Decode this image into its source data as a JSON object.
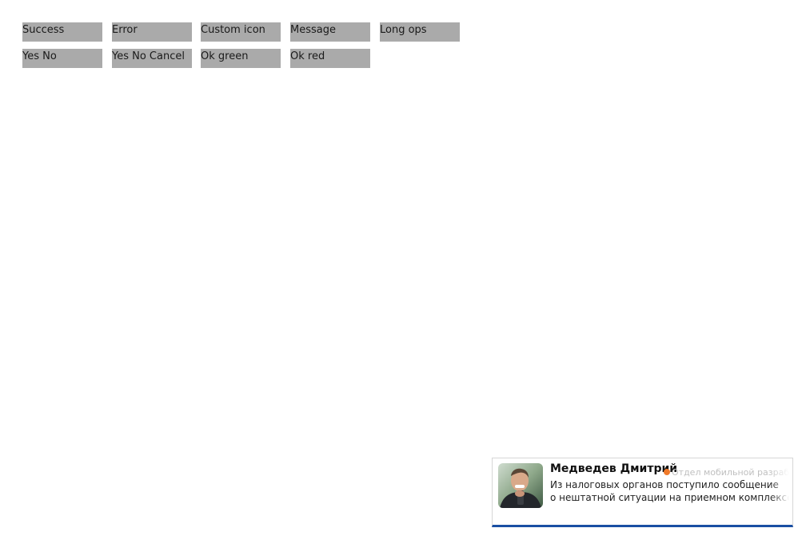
{
  "buttons": {
    "success": "Success",
    "error": "Error",
    "custom_icon": "Custom icon",
    "message": "Message",
    "long_ops": "Long ops",
    "yes_no": "Yes No",
    "yes_no_cancel": "Yes No Cancel",
    "ok_green": "Ok green",
    "ok_red": "Ok red"
  },
  "notification": {
    "sender": "Медведев Дмитрий",
    "department": "Отдел мобильной разработки",
    "message_line1": "Из налоговых органов поступило сообщение",
    "message_line2": "о нештатной ситуации на приемном комплексе",
    "status_dot_color": "#f07a2a",
    "accent_color": "#1a4fa3",
    "avatar_icon": "user-avatar-photo"
  }
}
